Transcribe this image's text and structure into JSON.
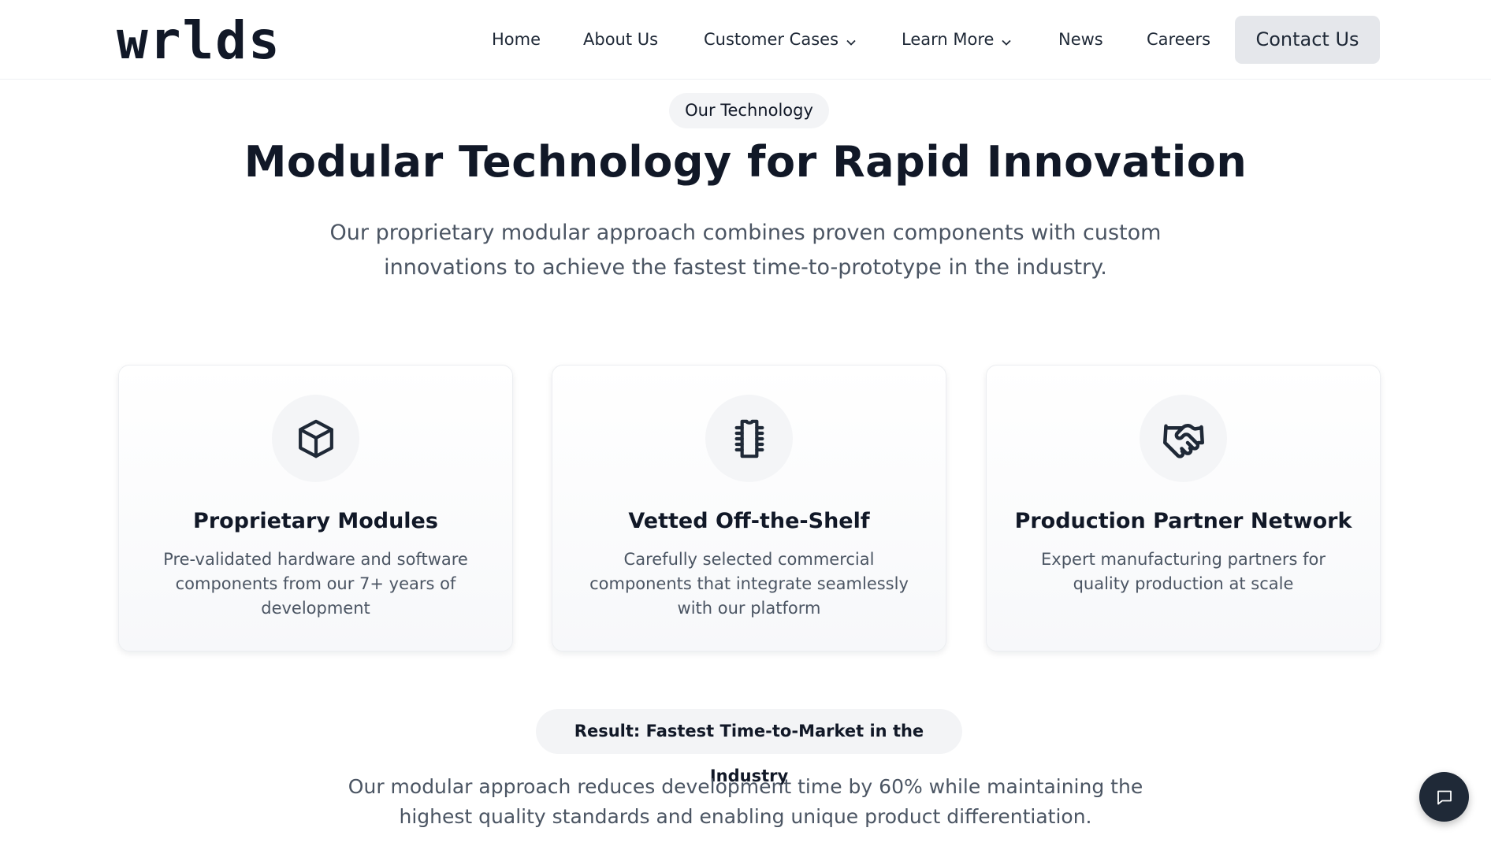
{
  "header": {
    "logo": "wrlds",
    "nav": {
      "home": "Home",
      "about": "About Us",
      "customer_cases": "Customer Cases",
      "learn_more": "Learn More",
      "news": "News",
      "careers": "Careers"
    },
    "contact": "Contact Us"
  },
  "hero": {
    "badge": "Our Technology",
    "title": "Modular Technology for Rapid Innovation",
    "subtitle": "Our proprietary modular approach combines proven components with custom innovations to achieve the fastest time-to-prototype in the industry."
  },
  "cards": [
    {
      "icon": "cube-icon",
      "title": "Proprietary Modules",
      "description": "Pre-validated hardware and software components from our 7+ years of development"
    },
    {
      "icon": "chip-icon",
      "title": "Vetted Off-the-Shelf",
      "description": "Carefully selected commercial components that integrate seamlessly with our platform"
    },
    {
      "icon": "handshake-icon",
      "title": "Production Partner Network",
      "description": "Expert manufacturing partners for quality production at scale"
    }
  ],
  "result": {
    "badge": "Result: Fastest Time-to-Market in the Industry",
    "text": "Our modular approach reduces development time by 60% while maintaining the highest quality standards and enabling unique product differentiation."
  },
  "chat": {
    "icon": "chat-icon"
  },
  "colors": {
    "text": "#111827",
    "muted": "#4b5563",
    "pill": "#f3f4f6",
    "contact_bg": "#e5e7eb",
    "chat_bg": "#1f2937"
  }
}
